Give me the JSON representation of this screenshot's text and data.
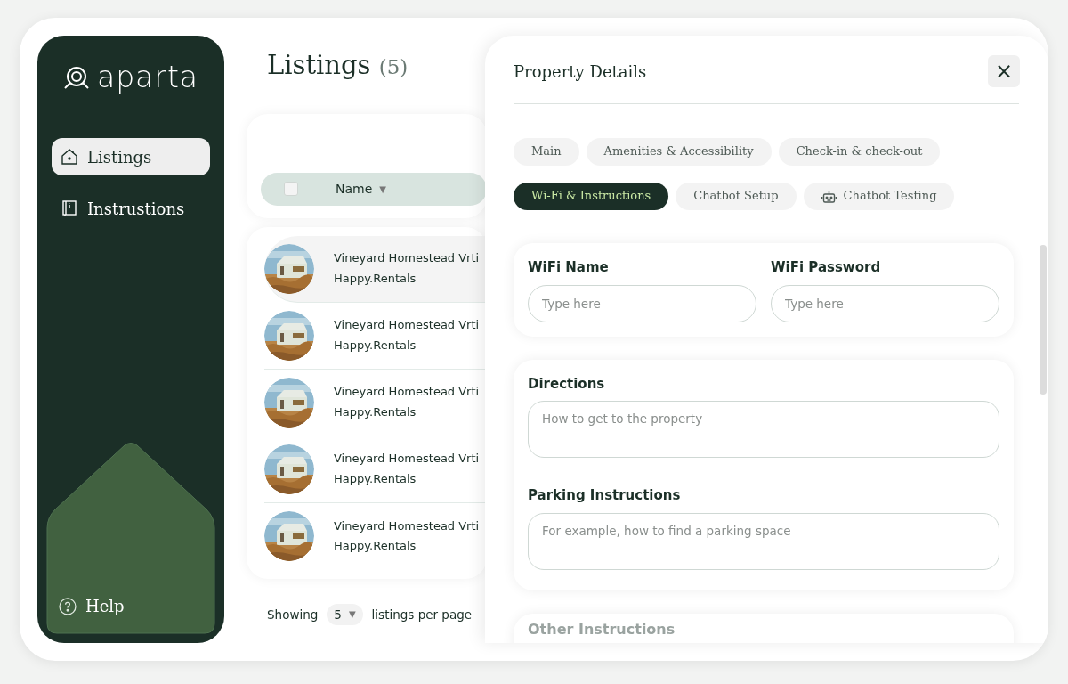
{
  "brand": {
    "name": "aparta"
  },
  "sidebar": {
    "items": [
      {
        "label": "Listings",
        "selected": true
      },
      {
        "label": "Instrustions",
        "selected": false
      }
    ],
    "help": "Help"
  },
  "listings": {
    "title": "Listings",
    "count": "(5)",
    "header": {
      "select_all_checked": false,
      "column": "Name",
      "sort": "▼"
    },
    "rows": [
      {
        "name": "Vineyard Homestead Vrti",
        "host": "Happy.Rentals",
        "hovered": true,
        "kind": "picture"
      },
      {
        "name": "Vineyard Homestead Vrti",
        "host": "Happy.Rentals",
        "hovered": false,
        "kind": "picture"
      },
      {
        "name": "Vineyard Homestead Vrti",
        "host": "Happy.Rentals",
        "hovered": false,
        "kind": "picture"
      },
      {
        "name": "Vineyard Homestead Vrti",
        "host": "Happy.Rentals",
        "hovered": false,
        "kind": "picture"
      },
      {
        "name": "Vineyard Homestead Vrti",
        "host": "Happy.Rentals",
        "hovered": false,
        "kind": "picture"
      }
    ],
    "footer": {
      "prefix": "Showing",
      "per_page": "5",
      "caret": "▼",
      "suffix": "listings per page"
    }
  },
  "panel": {
    "title": "Property Details",
    "close": "×",
    "tabs": [
      {
        "label": "Main",
        "selected": false,
        "kind": "text"
      },
      {
        "label": "Amenities & Accessibility",
        "selected": false,
        "kind": "text"
      },
      {
        "label": "Check-in & check-out",
        "selected": false,
        "kind": "text"
      },
      {
        "label": "Wi-Fi & Instructions",
        "selected": true,
        "kind": "text"
      },
      {
        "label": "Chatbot Setup",
        "selected": false,
        "kind": "text"
      },
      {
        "label": "Chatbot Testing",
        "selected": false,
        "kind": "icon"
      }
    ],
    "sections": [
      {
        "kind": "row",
        "fields": [
          {
            "label": "WiFi Name",
            "placeholder": "Type here",
            "kind": "input"
          },
          {
            "label": "WiFi Password",
            "placeholder": "Type here",
            "kind": "input"
          }
        ]
      },
      {
        "kind": "stack",
        "fields": [
          {
            "label": "Directions",
            "placeholder": "How to get to the property",
            "kind": "textarea"
          },
          {
            "label": "Parking Instructions",
            "placeholder": "For example, how to find a parking space",
            "kind": "textarea"
          }
        ]
      }
    ],
    "next_section": "Other Instructions"
  }
}
